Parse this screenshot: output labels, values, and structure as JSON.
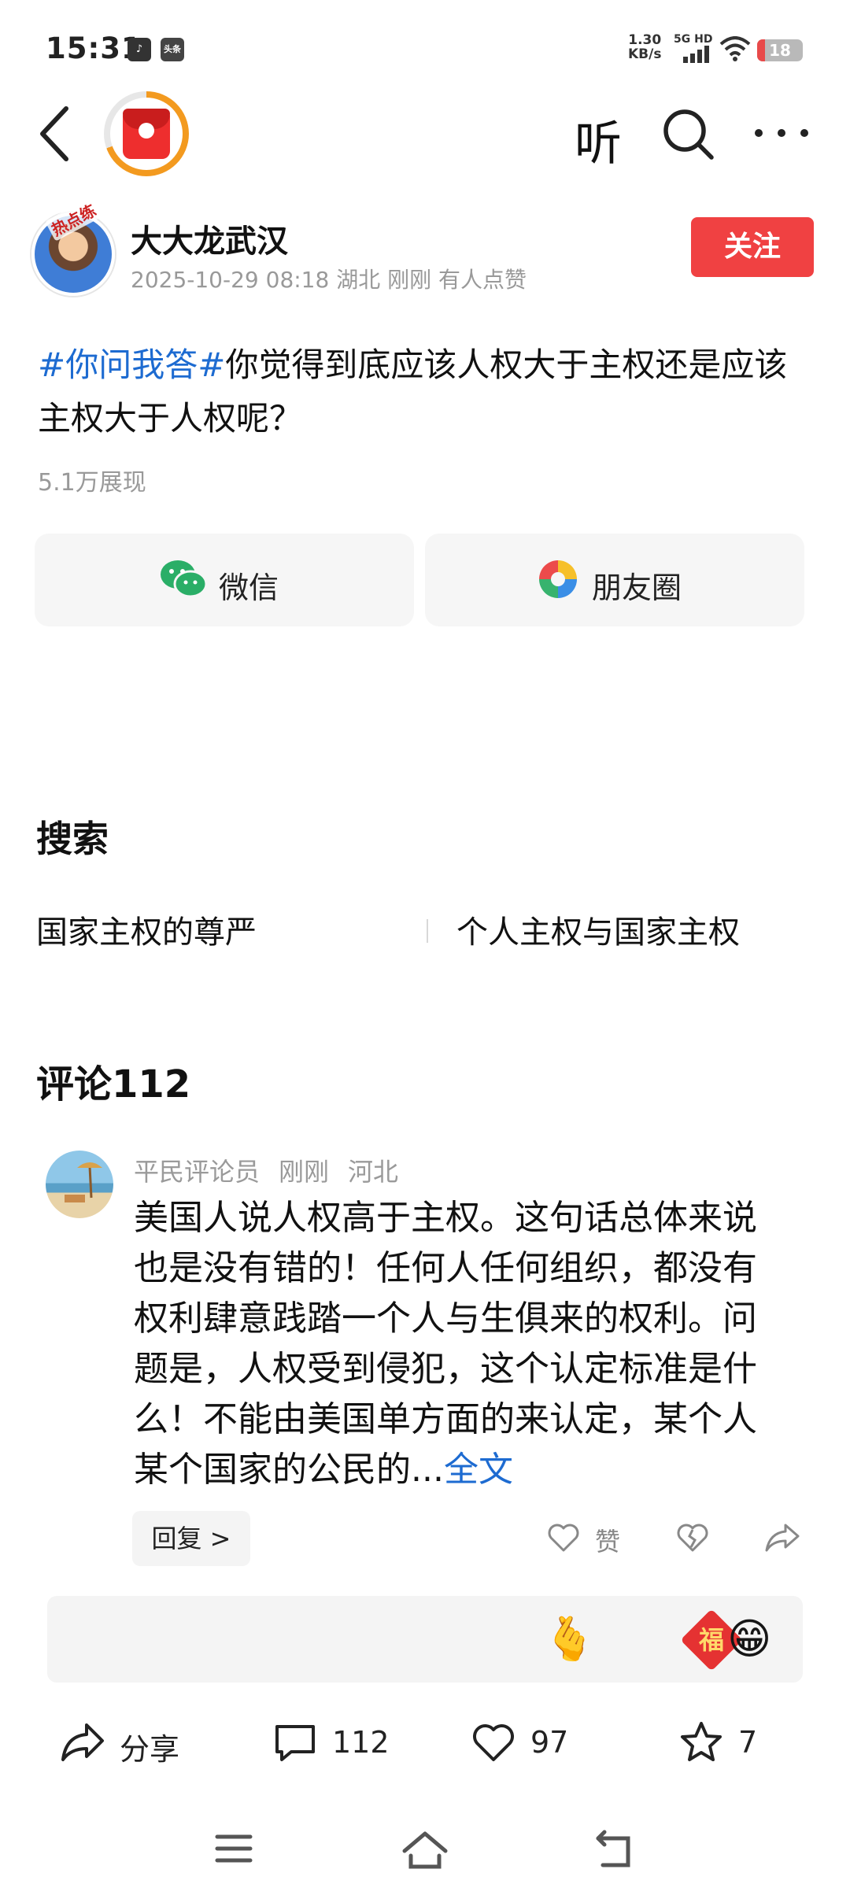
{
  "status_bar": {
    "time": "15:31",
    "app_icons": [
      "tiktok-icon",
      "toutiao-icon"
    ],
    "app_icon_text": "头条",
    "speed_value": "1.30",
    "speed_unit": "KB/s",
    "network": "5G HD",
    "battery": "18",
    "battery_color": "#e84a4a"
  },
  "nav": {
    "listen_label": "听",
    "icons": [
      "back-arrow-icon",
      "red-packet-icon",
      "search-icon",
      "more-icon"
    ]
  },
  "author": {
    "name": "大大龙武汉",
    "badge": "热点练",
    "meta": "2025-10-29 08:18 湖北 刚刚 有人点赞",
    "follow_label": "关注",
    "follow_color": "#f04142"
  },
  "post": {
    "hashtag": "#你问我答#",
    "text": "你觉得到底应该人权大于主权还是应该主权大于人权呢？",
    "impressions": "5.1万展现",
    "hashtag_color": "#1d6bd1"
  },
  "share": {
    "wechat_label": "微信",
    "moments_label": "朋友圈"
  },
  "search": {
    "title": "搜索",
    "items": [
      "国家主权的尊严",
      "个人主权与国家主权"
    ]
  },
  "comments": {
    "title": "评论112",
    "items": [
      {
        "user": "平民评论员",
        "time": "刚刚",
        "location": "河北",
        "text": "美国人说人权高于主权。这句话总体来说也是没有错的！任何人任何组织，都没有权利肆意践踏一个人与生俱来的权利。问题是，人权受到侵犯，这个认定标准是什么！不能由美国单方面的来认定，某个人某个国家的公民的...",
        "more_label": "全文",
        "reply_label": "回复 >",
        "like_label": "赞"
      }
    ]
  },
  "input_bar": {
    "placeholder": "",
    "emojis": [
      "🫰",
      "😁"
    ],
    "fu_label": "福"
  },
  "actions": {
    "share_label": "分享",
    "comments_count": "112",
    "likes_count": "97",
    "favorites_count": "7"
  }
}
